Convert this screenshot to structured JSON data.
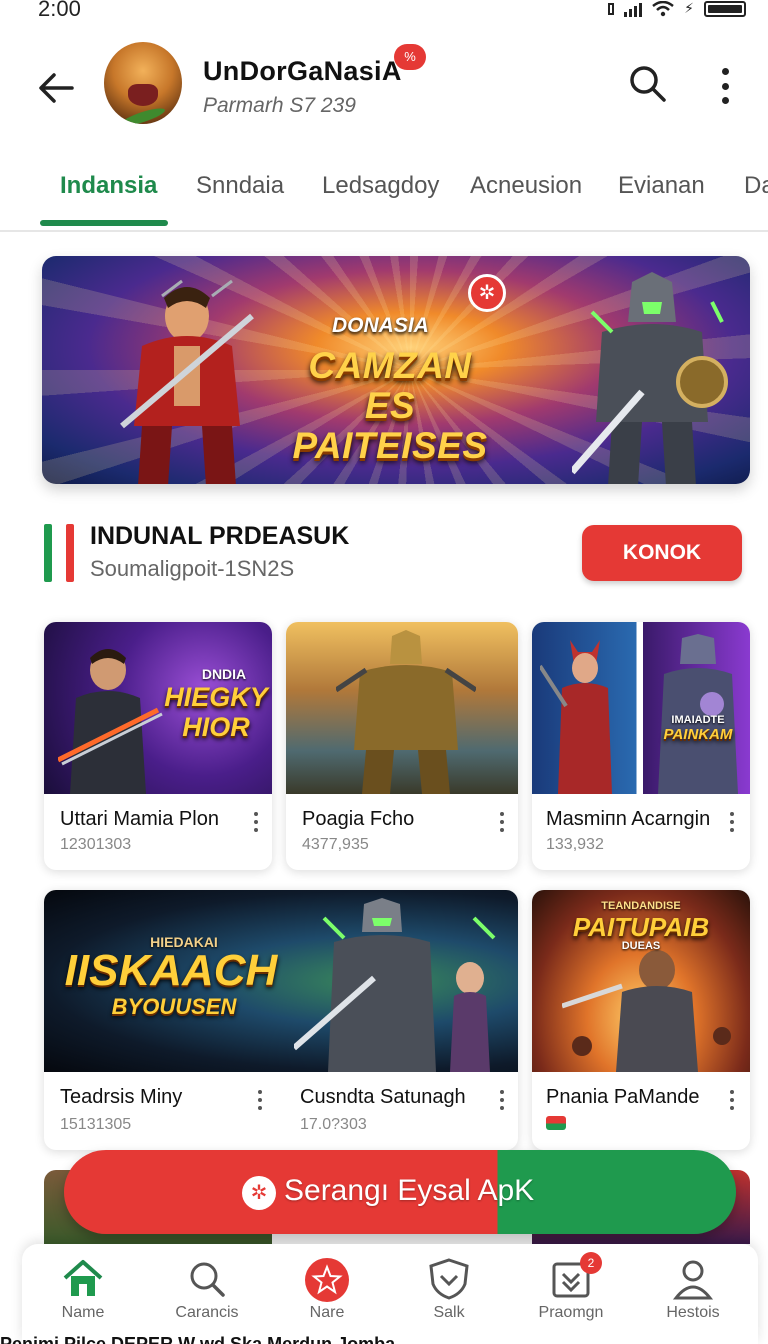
{
  "status": {
    "time": "2:00"
  },
  "header": {
    "title": "UnDorGaNasiA",
    "subtitle": "Parmarh S7 239",
    "badge": "%",
    "back_icon": "arrow-left-icon",
    "search_icon": "search-icon",
    "more_icon": "more-vertical-icon"
  },
  "tabs": [
    {
      "label": "Indansia",
      "active": true
    },
    {
      "label": "Snndaia"
    },
    {
      "label": "Ledsagdoy"
    },
    {
      "label": "Acneusion"
    },
    {
      "label": "Evianan"
    },
    {
      "label": "Da"
    }
  ],
  "banner": {
    "top_text": "DONASIA",
    "main_line1": "CAMZAN ES",
    "main_line2": "PAITEISES"
  },
  "section": {
    "title": "INDUNAL PRDEASUK",
    "subtitle": "Soumaligpoit-1SN2S",
    "button": "KONOK",
    "flag_colors": [
      "#1f9a4e",
      "#e53935"
    ]
  },
  "cards": [
    {
      "name": "Uttari Mamia Plon",
      "count": "12301303",
      "art_small": "DNDIA",
      "art_title1": "HIEGKY",
      "art_title2": "HIOR"
    },
    {
      "name": "Poagia Fcho",
      "count": "4377,935"
    },
    {
      "name": "Masmiпn Acarngin",
      "count": "133,932",
      "art_small": "IMAIADTE",
      "art_title1": "PAINKAM"
    },
    {
      "name": "Teadrsis Miny",
      "count": "15131305",
      "art_small": "HIEDAKAI",
      "art_title1": "IISKAACH",
      "art_title2": "BYOUUSEN"
    },
    {
      "name": "Cusndta Satunagh",
      "count": "17.0?303"
    },
    {
      "name": "Pnania PaMande",
      "count": "",
      "art_small": "TEANDANDISE",
      "art_title1": "PAITUPAIB",
      "art_small2": "DUEAS"
    }
  ],
  "cta": {
    "label": "Serangı Eysal ApK"
  },
  "bottom_nav": [
    {
      "label": "Name",
      "icon": "home-icon",
      "active": true
    },
    {
      "label": "Carancis",
      "icon": "search-icon"
    },
    {
      "label": "Nare",
      "icon": "star-icon"
    },
    {
      "label": "Salk",
      "icon": "shield-icon"
    },
    {
      "label": "Praomgn",
      "icon": "download-icon",
      "badge": "2"
    },
    {
      "label": "Hestois",
      "icon": "profile-icon"
    }
  ],
  "bottom_strip": "Penimi  Pilce  DEPER  W  wd  Ska  Merdun  Jomba",
  "colors": {
    "accent_green": "#1f8a4c",
    "accent_red": "#e53935"
  }
}
